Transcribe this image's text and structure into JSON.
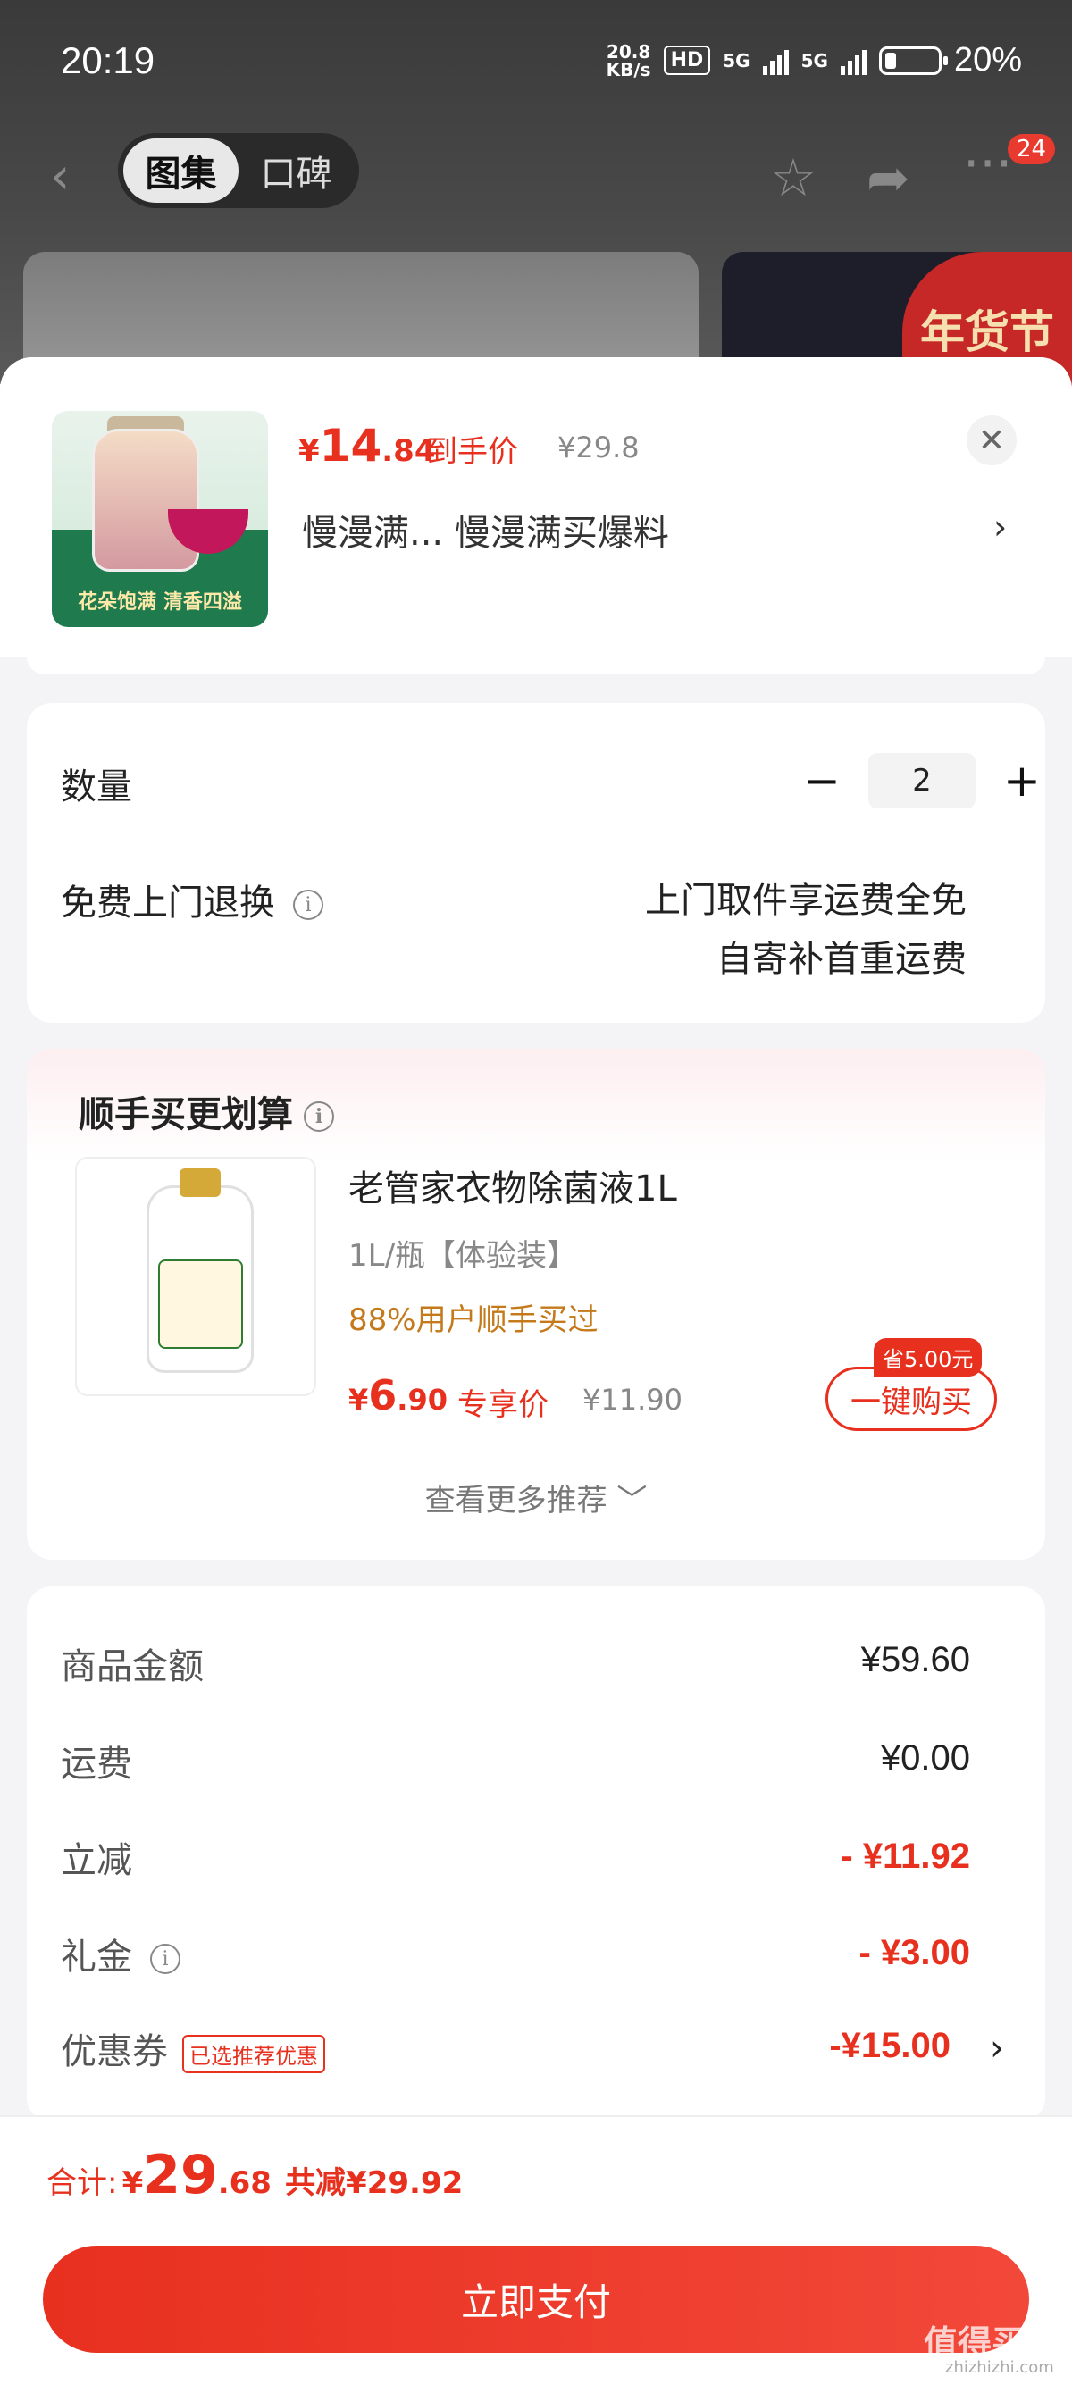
{
  "status_bar": {
    "time": "20:19",
    "net_speed_top": "20.8",
    "net_speed_unit": "KB/s",
    "hd_label": "HD",
    "net_type_1": "5G",
    "net_type_2": "5G",
    "battery_pct": "20%"
  },
  "nav": {
    "tabs": [
      "图集",
      "口碑"
    ],
    "active_tab": 0,
    "more_badge": "24"
  },
  "banner": {
    "festival_text": "年货节"
  },
  "product": {
    "price_currency": "¥",
    "price_int": "14",
    "price_dec": ".84",
    "price_tag": "到手价",
    "orig_price": "¥29.8",
    "name": "慢漫满...  慢漫满买爆料",
    "image_caption": "花朵饱满 清香四溢"
  },
  "quantity": {
    "label": "数量",
    "minus": "−",
    "value": "2",
    "plus": "+"
  },
  "returns": {
    "label": "免费上门退换",
    "line1": "上门取件享运费全免",
    "line2": "自寄补首重运费"
  },
  "recommend": {
    "title": "顺手买更划算",
    "name": "老管家衣物除菌液1L",
    "spec": "1L/瓶【体验装】",
    "buyers": "88%用户顺手买过",
    "price_currency": "¥",
    "price_int": "6",
    "price_dec": ".90",
    "price_tag": "专享价",
    "orig_price": "¥11.90",
    "save_badge": "省5.00元",
    "buy_button": "一键购买",
    "more": "查看更多推荐 ﹀"
  },
  "summary": {
    "goods_label": "商品金额",
    "goods_value": "¥59.60",
    "shipping_label": "运费",
    "shipping_value": "¥0.00",
    "discount_label": "立减",
    "discount_value": "- ¥11.92",
    "gift_label": "礼金",
    "gift_value": "- ¥3.00",
    "coupon_label": "优惠券",
    "coupon_chip": "已选推荐优惠",
    "coupon_value": "-¥15.00"
  },
  "footer": {
    "total_label": "合计:",
    "total_currency": "¥",
    "total_int": "29",
    "total_dec": ".68",
    "saved": "共减¥29.92",
    "pay_button": "立即支付",
    "watermark": "值得买",
    "watermark_url": "zhizhizhi.com"
  },
  "colors": {
    "accent": "#e8301f",
    "buyers": "#c47a1a"
  }
}
